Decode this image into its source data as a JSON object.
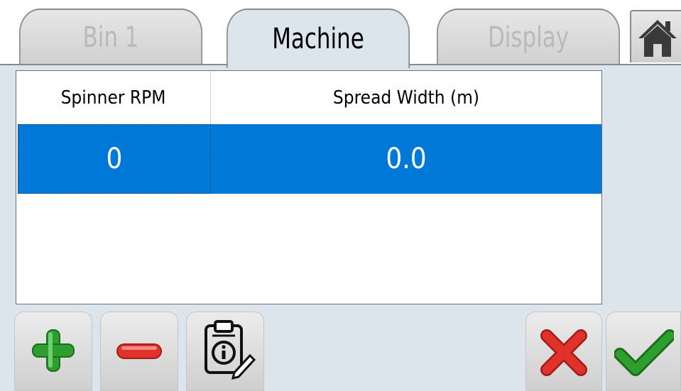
{
  "tabs": [
    {
      "label": "Bin 1",
      "active": false
    },
    {
      "label": "Machine",
      "active": true
    },
    {
      "label": "Display",
      "active": false
    }
  ],
  "table": {
    "columns": [
      "Spinner RPM",
      "Spread Width (m)"
    ],
    "rows": [
      {
        "spinner_rpm": "0",
        "spread_width": "0.0",
        "selected": true
      }
    ]
  },
  "icons": {
    "home": "home-icon",
    "add": "plus-icon",
    "remove": "minus-icon",
    "info": "clipboard-info-icon",
    "cancel": "x-icon",
    "confirm": "checkmark-icon"
  },
  "colors": {
    "selection": "#0078d7",
    "add": "#2e9e2e",
    "remove": "#e0322b",
    "cancel": "#e0322b",
    "confirm": "#2e9e2e"
  }
}
